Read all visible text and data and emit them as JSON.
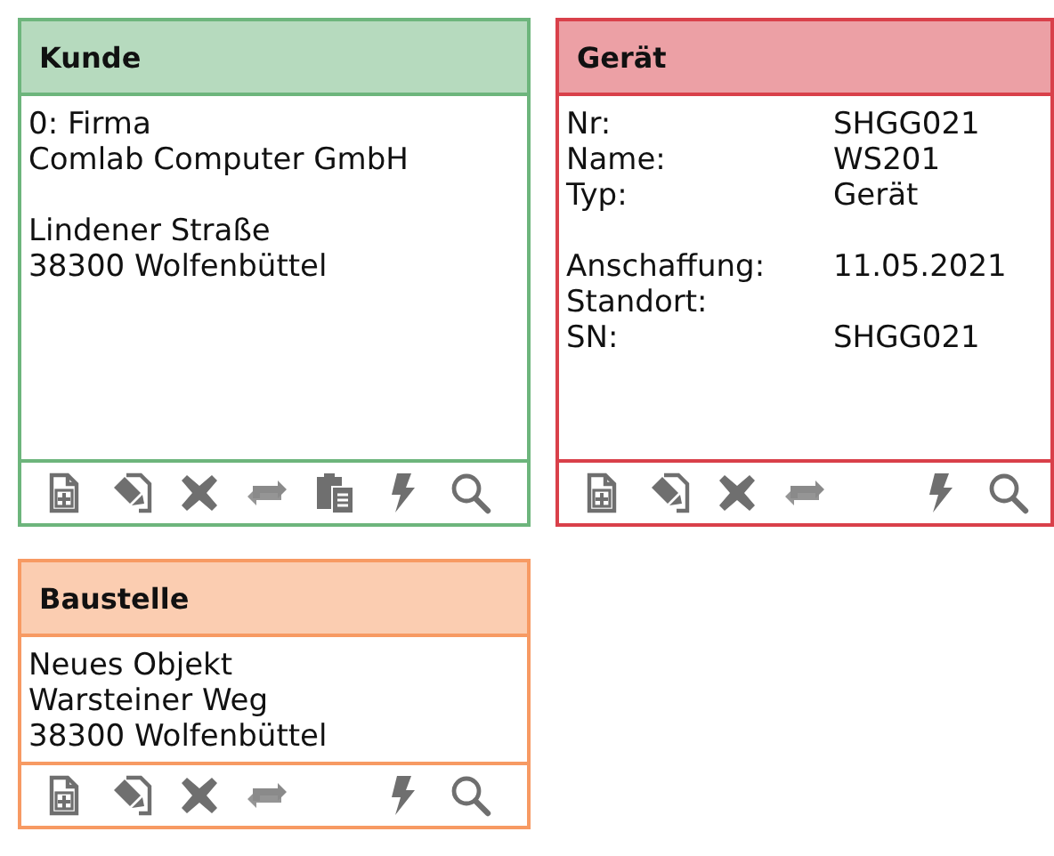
{
  "cards": [
    {
      "title": "Kunde",
      "color": "#6db57c",
      "kind": "lines",
      "blocks": [
        [
          "0: Firma",
          "Comlab Computer GmbH"
        ],
        [
          "Lindener Straße",
          "38300 Wolfenbüttel"
        ]
      ],
      "actions": [
        {
          "kind": "new"
        },
        {
          "kind": "edit"
        },
        {
          "kind": "delete"
        },
        {
          "kind": "swap"
        },
        {
          "kind": "paste"
        },
        {
          "kind": "flash"
        },
        {
          "kind": "search"
        }
      ]
    },
    {
      "title": "Gerät",
      "color": "#d9404a",
      "kind": "fields",
      "blocks": [
        [
          {
            "label": "Nr:",
            "value": "SHGG021"
          },
          {
            "label": "Name:",
            "value": "WS201"
          },
          {
            "label": "Typ:",
            "value": "Gerät"
          }
        ],
        [
          {
            "label": "Anschaffung:",
            "value": "11.05.2021"
          },
          {
            "label": "Standort:"
          },
          {
            "label": "SN:",
            "value": "SHGG021"
          }
        ]
      ],
      "actions": [
        {
          "kind": "new"
        },
        {
          "kind": "edit"
        },
        {
          "kind": "delete"
        },
        {
          "kind": "swap"
        },
        {
          "kind": "flash"
        },
        {
          "kind": "search"
        }
      ]
    },
    {
      "title": "Baustelle",
      "color": "#f79a63",
      "kind": "lines",
      "blocks": [
        [
          "Neues Objekt",
          "Warsteiner Weg",
          "38300 Wolfenbüttel"
        ]
      ],
      "actions": [
        {
          "kind": "new"
        },
        {
          "kind": "edit"
        },
        {
          "kind": "delete"
        },
        {
          "kind": "swap"
        },
        {
          "kind": "flash"
        },
        {
          "kind": "search"
        }
      ]
    }
  ]
}
